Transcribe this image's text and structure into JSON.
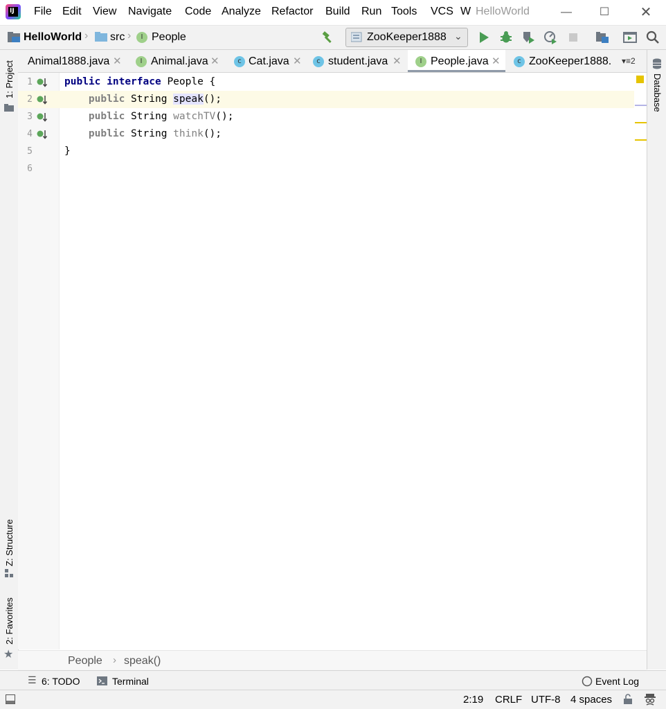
{
  "menu": {
    "items": [
      "File",
      "Edit",
      "View",
      "Navigate",
      "Code",
      "Analyze",
      "Refactor",
      "Build",
      "Run",
      "Tools",
      "VCS",
      "W"
    ],
    "window_title": "HelloWorld",
    "window_controls": [
      "minimize-icon",
      "maximize-icon",
      "close-icon"
    ]
  },
  "navbar": {
    "crumbs": [
      "HelloWorld",
      "src",
      "People"
    ],
    "run_config": "ZooKeeper1888"
  },
  "tabs": [
    {
      "label": "Animal1888.java",
      "kind": "C",
      "active": false
    },
    {
      "label": "Animal.java",
      "kind": "I",
      "active": false
    },
    {
      "label": "Cat.java",
      "kind": "C",
      "active": false
    },
    {
      "label": "student.java",
      "kind": "C",
      "active": false
    },
    {
      "label": "People.java",
      "kind": "I",
      "active": true
    },
    {
      "label": "ZooKeeper1888.",
      "kind": "C",
      "active": false
    }
  ],
  "tabs_overflow": "2",
  "left_strip": {
    "project": "1: Project",
    "structure": "Z: Structure",
    "favorites": "2: Favorites"
  },
  "right_strip": {
    "database": "Database"
  },
  "editor": {
    "line_numbers": [
      "1",
      "2",
      "3",
      "4",
      "5",
      "6"
    ],
    "lines": {
      "l1_kw1": "public",
      "l1_kw2": "interface",
      "l1_rest": "People {",
      "l2_kw": "public",
      "l2_type": "String",
      "l2_method": "speak",
      "l2_tail": "();",
      "l3_kw": "public",
      "l3_type": "String",
      "l3_method": "watchTV",
      "l3_tail": "();",
      "l4_kw": "public",
      "l4_type": "String",
      "l4_method": "think",
      "l4_tail": "();",
      "l5": "}"
    }
  },
  "editor_breadcrumb": [
    "People",
    "speak()"
  ],
  "bottom_tools": {
    "todo": "6: TODO",
    "terminal": "Terminal",
    "event_log": "Event Log"
  },
  "status": {
    "position": "2:19",
    "line_sep": "CRLF",
    "encoding": "UTF-8",
    "indent": "4 spaces"
  }
}
